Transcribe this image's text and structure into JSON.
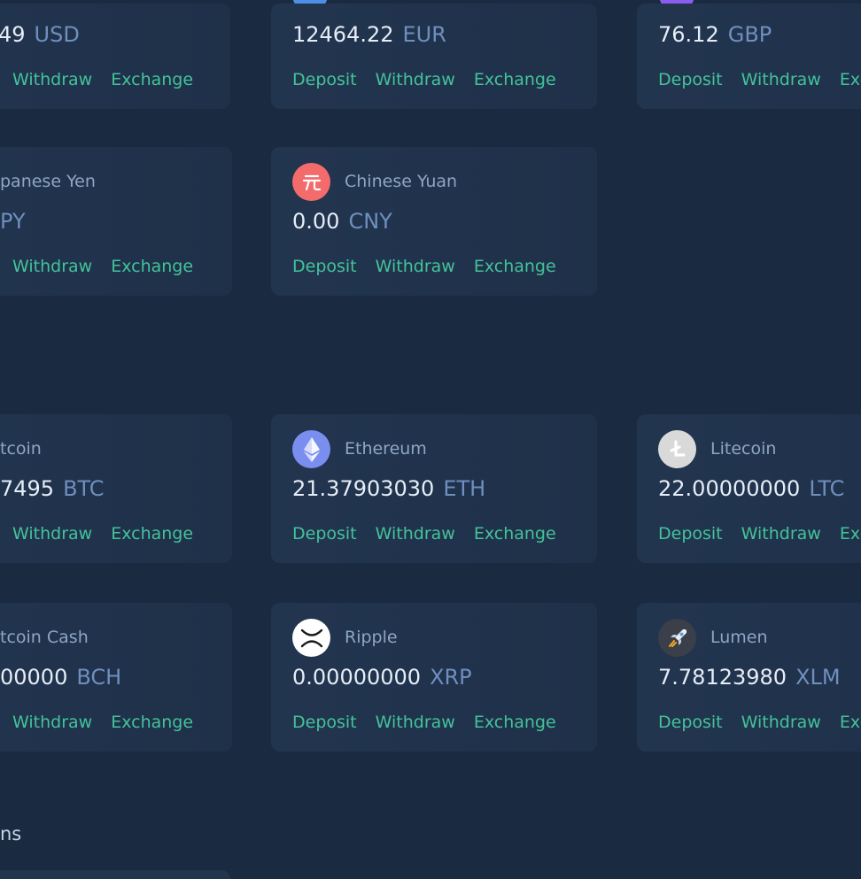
{
  "actions": {
    "deposit": "Deposit",
    "withdraw": "Withdraw",
    "exchange": "Exchange"
  },
  "fiat": [
    {
      "name": "",
      "amount": "49",
      "code": "USD"
    },
    {
      "name": "",
      "amount": "12464.22",
      "code": "EUR"
    },
    {
      "name": "",
      "amount": "76.12",
      "code": "GBP"
    },
    {
      "name": "panese Yen",
      "amount": "",
      "code": "PY"
    },
    {
      "name": "Chinese Yuan",
      "amount": "0.00",
      "code": "CNY"
    }
  ],
  "crypto": [
    {
      "name": "tcoin",
      "amount": "7495",
      "code": "BTC"
    },
    {
      "name": "Ethereum",
      "amount": "21.37903030",
      "code": "ETH"
    },
    {
      "name": "Litecoin",
      "amount": "22.00000000",
      "code": "LTC"
    },
    {
      "name": "tcoin Cash",
      "amount": "00000",
      "code": "BCH"
    },
    {
      "name": "Ripple",
      "amount": "0.00000000",
      "code": "XRP"
    },
    {
      "name": "Lumen",
      "amount": "7.78123980",
      "code": "XLM"
    }
  ],
  "section": {
    "label": "ns"
  },
  "colors": {
    "background": "#1a2a41",
    "card": "#22354f",
    "action": "#43c39a",
    "code": "#6f8fbf",
    "yuan_icon": "#f36b6b",
    "eth_icon": "#7a8ef0",
    "euro_icon": "#4d8fe6",
    "gbp_icon": "#8a5cf0"
  },
  "icons": {
    "yuan": "yuan-icon",
    "eth": "ethereum-icon",
    "ltc": "litecoin-icon",
    "xrp": "ripple-icon",
    "xlm": "rocket-icon"
  }
}
